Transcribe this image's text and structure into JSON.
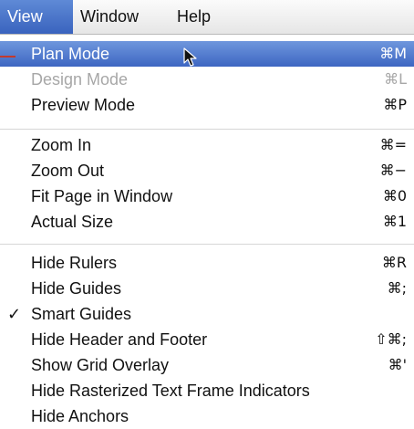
{
  "menubar": {
    "items": [
      {
        "label": "View",
        "active": true
      },
      {
        "label": "Window",
        "active": false
      },
      {
        "label": "Help",
        "active": false
      }
    ]
  },
  "menu": {
    "items": [
      {
        "label": "Plan Mode",
        "shortcut": "⌘M",
        "state": "highlighted"
      },
      {
        "label": "Design Mode",
        "shortcut": "⌘L",
        "state": "disabled"
      },
      {
        "label": "Preview Mode",
        "shortcut": "⌘P",
        "state": "normal"
      },
      {
        "label": "Zoom In",
        "shortcut": "⌘=",
        "state": "normal"
      },
      {
        "label": "Zoom Out",
        "shortcut": "⌘−",
        "state": "normal"
      },
      {
        "label": "Fit Page in Window",
        "shortcut": "⌘0",
        "state": "normal"
      },
      {
        "label": "Actual Size",
        "shortcut": "⌘1",
        "state": "normal"
      },
      {
        "label": "Hide Rulers",
        "shortcut": "⌘R",
        "state": "normal"
      },
      {
        "label": "Hide Guides",
        "shortcut": "⌘;",
        "state": "normal"
      },
      {
        "label": "Smart Guides",
        "shortcut": "",
        "state": "checked"
      },
      {
        "label": "Hide Header and Footer",
        "shortcut": "⇧⌘;",
        "state": "normal"
      },
      {
        "label": "Show Grid Overlay",
        "shortcut": "⌘'",
        "state": "normal"
      },
      {
        "label": "Hide Rasterized Text Frame Indicators",
        "shortcut": "",
        "state": "normal"
      },
      {
        "label": "Hide Anchors",
        "shortcut": "",
        "state": "normal"
      }
    ],
    "checkmark_glyph": "✓"
  },
  "colors": {
    "highlight": "#3d66c2",
    "disabled_text": "#a7a7a7",
    "annotation_line": "#c23a2e"
  },
  "icons": {
    "cursor": "arrow-pointer-icon",
    "checkmark": "checkmark-icon"
  }
}
